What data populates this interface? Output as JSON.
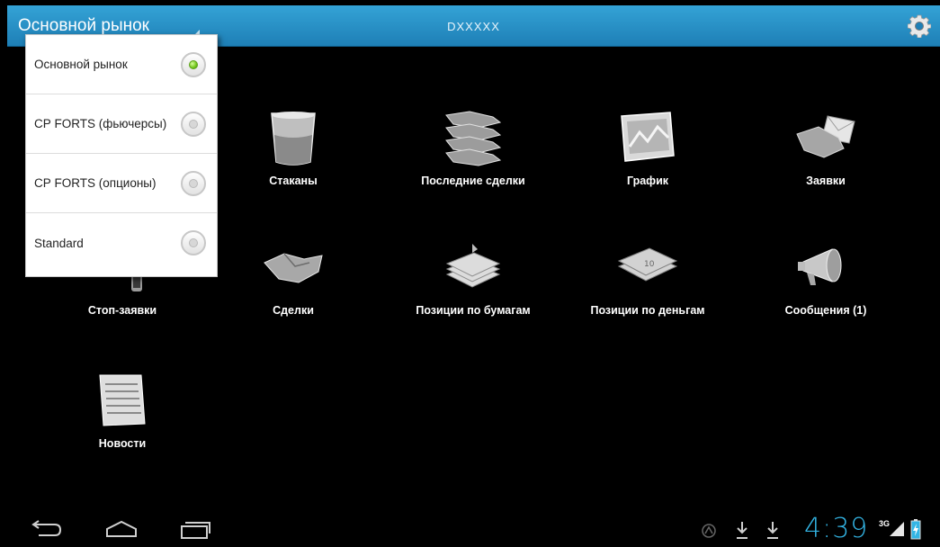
{
  "actionbar": {
    "market_label": "Основной рынок",
    "title": "DXXXXX",
    "settings_icon": "gear-icon"
  },
  "tiles": [
    {
      "label": "Стаканы",
      "icon": "glass-icon"
    },
    {
      "label": "Последние сделки",
      "icon": "handshakes-stack-icon"
    },
    {
      "label": "График",
      "icon": "chart-icon"
    },
    {
      "label": "Заявки",
      "icon": "handshake-envelope-icon"
    },
    {
      "label": "Стоп-заявки",
      "icon": "stop-order-icon"
    },
    {
      "label": "Сделки",
      "icon": "handshake-icon"
    },
    {
      "label": "Позиции по бумагам",
      "icon": "papers-stack-icon"
    },
    {
      "label": "Позиции по деньгам",
      "icon": "money-stack-icon"
    },
    {
      "label": "Сообщения (1)",
      "icon": "megaphone-icon"
    },
    {
      "label": "Новости",
      "icon": "newspaper-icon"
    }
  ],
  "dropdown": {
    "items": [
      {
        "label": "Основной рынок",
        "selected": true
      },
      {
        "label": "СР FORTS (фьючерсы)",
        "selected": false
      },
      {
        "label": "СР FORTS (опционы)",
        "selected": false
      },
      {
        "label": "Standard",
        "selected": false
      }
    ]
  },
  "statusbar": {
    "time": "4:39",
    "network": "3G"
  }
}
